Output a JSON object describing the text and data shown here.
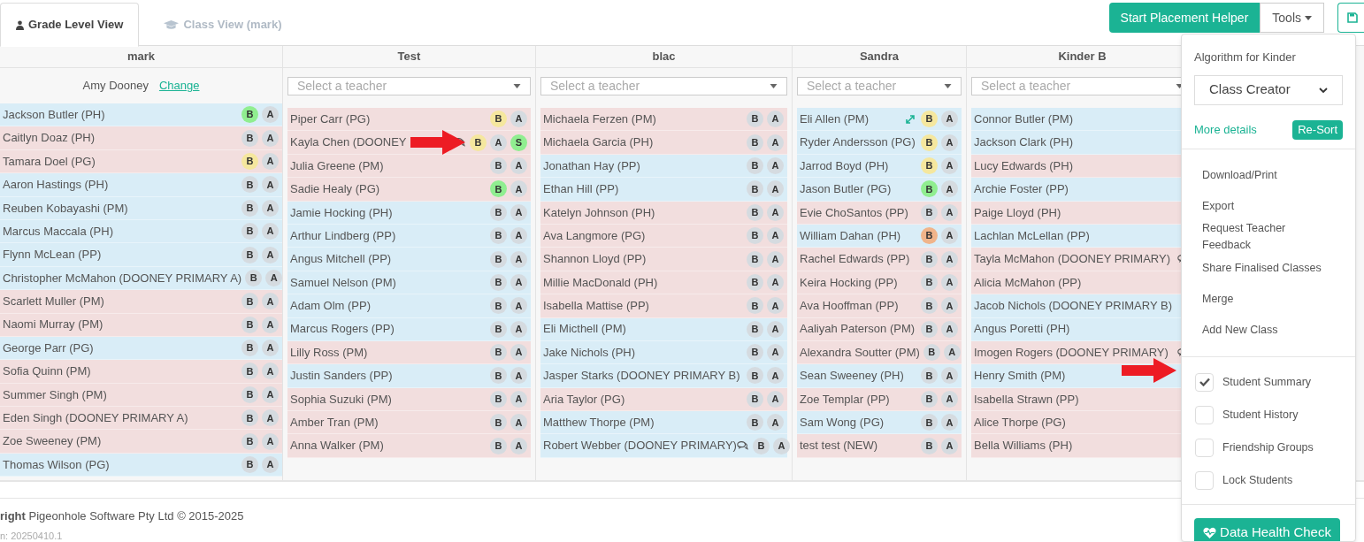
{
  "tabs": [
    {
      "label": "Grade Level View",
      "selected": true
    },
    {
      "label": "Class View (mark)",
      "selected": false
    }
  ],
  "toolbar": {
    "primary_button": "Start Placement Helper",
    "tools_button": "Tools"
  },
  "classes": [
    {
      "name": "mark",
      "teacher": {
        "name": "Amy Dooney",
        "action": "Change"
      },
      "students": [
        {
          "name": "Jackson Butler (PH)",
          "color": "#d9edf7",
          "badges": [
            {
              "letter": "B",
              "color": "#90ee90"
            },
            {
              "letter": "A",
              "color": "#d5dbe0"
            }
          ]
        },
        {
          "name": "Caitlyn Doaz (PH)",
          "color": "#f2dede",
          "badges": [
            {
              "letter": "B",
              "color": "#d5dbe0"
            },
            {
              "letter": "A",
              "color": "#d5dbe0"
            }
          ]
        },
        {
          "name": "Tamara Doel (PG)",
          "color": "#f2dede",
          "badges": [
            {
              "letter": "B",
              "color": "#f5e79e"
            },
            {
              "letter": "A",
              "color": "#d5dbe0"
            }
          ]
        },
        {
          "name": "Aaron Hastings (PH)",
          "color": "#d9edf7",
          "badges": [
            {
              "letter": "B",
              "color": "#d5dbe0"
            },
            {
              "letter": "A",
              "color": "#d5dbe0"
            }
          ]
        },
        {
          "name": "Reuben Kobayashi (PM)",
          "color": "#d9edf7",
          "badges": [
            {
              "letter": "B",
              "color": "#d5dbe0"
            },
            {
              "letter": "A",
              "color": "#d5dbe0"
            }
          ]
        },
        {
          "name": "Marcus Maccala (PH)",
          "color": "#d9edf7",
          "badges": [
            {
              "letter": "B",
              "color": "#d5dbe0"
            },
            {
              "letter": "A",
              "color": "#d5dbe0"
            }
          ]
        },
        {
          "name": "Flynn McLean (PP)",
          "color": "#d9edf7",
          "badges": [
            {
              "letter": "B",
              "color": "#d5dbe0"
            },
            {
              "letter": "A",
              "color": "#d5dbe0"
            }
          ]
        },
        {
          "name": "Christopher McMahon (DOONEY PRIMARY A)",
          "color": "#d9edf7",
          "badges": [
            {
              "letter": "B",
              "color": "#d5dbe0"
            },
            {
              "letter": "A",
              "color": "#d5dbe0"
            }
          ]
        },
        {
          "name": "Scarlett Muller (PM)",
          "color": "#f2dede",
          "badges": [
            {
              "letter": "B",
              "color": "#d5dbe0"
            },
            {
              "letter": "A",
              "color": "#d5dbe0"
            }
          ]
        },
        {
          "name": "Naomi Murray (PM)",
          "color": "#f2dede",
          "badges": [
            {
              "letter": "B",
              "color": "#d5dbe0"
            },
            {
              "letter": "A",
              "color": "#d5dbe0"
            }
          ]
        },
        {
          "name": "George Parr (PG)",
          "color": "#d9edf7",
          "badges": [
            {
              "letter": "B",
              "color": "#d5dbe0"
            },
            {
              "letter": "A",
              "color": "#d5dbe0"
            }
          ]
        },
        {
          "name": "Sofia Quinn (PM)",
          "color": "#f2dede",
          "badges": [
            {
              "letter": "B",
              "color": "#d5dbe0"
            },
            {
              "letter": "A",
              "color": "#d5dbe0"
            }
          ]
        },
        {
          "name": "Summer Singh (PM)",
          "color": "#f2dede",
          "badges": [
            {
              "letter": "B",
              "color": "#d5dbe0"
            },
            {
              "letter": "A",
              "color": "#d5dbe0"
            }
          ]
        },
        {
          "name": "Eden Singh (DOONEY PRIMARY A)",
          "color": "#f2dede",
          "badges": [
            {
              "letter": "B",
              "color": "#d5dbe0"
            },
            {
              "letter": "A",
              "color": "#d5dbe0"
            }
          ]
        },
        {
          "name": "Zoe Sweeney (PM)",
          "color": "#f2dede",
          "badges": [
            {
              "letter": "B",
              "color": "#d5dbe0"
            },
            {
              "letter": "A",
              "color": "#d5dbe0"
            }
          ]
        },
        {
          "name": "Thomas Wilson (PG)",
          "color": "#d9edf7",
          "badges": [
            {
              "letter": "B",
              "color": "#d5dbe0"
            },
            {
              "letter": "A",
              "color": "#d5dbe0"
            }
          ]
        }
      ]
    },
    {
      "name": "Test",
      "teacher": {
        "placeholder": "Select a teacher"
      },
      "students": [
        {
          "name": "Piper Carr (PG)",
          "color": "#f2dede",
          "badges": [
            {
              "letter": "B",
              "color": "#f5e79e"
            },
            {
              "letter": "A",
              "color": "#d5dbe0"
            }
          ]
        },
        {
          "name": "Kayla Chen (DOONEY",
          "color": "#f2dede",
          "comment": true,
          "badges": [
            {
              "letter": "B",
              "color": "#f5e79e"
            },
            {
              "letter": "A",
              "color": "#d5dbe0"
            },
            {
              "letter": "S",
              "color": "#90ee90"
            }
          ]
        },
        {
          "name": "Julia Greene (PM)",
          "color": "#f2dede",
          "badges": [
            {
              "letter": "B",
              "color": "#d5dbe0"
            },
            {
              "letter": "A",
              "color": "#d5dbe0"
            }
          ]
        },
        {
          "name": "Sadie Healy (PG)",
          "color": "#f2dede",
          "badges": [
            {
              "letter": "B",
              "color": "#90ee90"
            },
            {
              "letter": "A",
              "color": "#d5dbe0"
            }
          ]
        },
        {
          "name": "Jamie Hocking (PH)",
          "color": "#d9edf7",
          "badges": [
            {
              "letter": "B",
              "color": "#d5dbe0"
            },
            {
              "letter": "A",
              "color": "#d5dbe0"
            }
          ]
        },
        {
          "name": "Arthur Lindberg (PP)",
          "color": "#d9edf7",
          "badges": [
            {
              "letter": "B",
              "color": "#d5dbe0"
            },
            {
              "letter": "A",
              "color": "#d5dbe0"
            }
          ]
        },
        {
          "name": "Angus Mitchell (PP)",
          "color": "#d9edf7",
          "badges": [
            {
              "letter": "B",
              "color": "#d5dbe0"
            },
            {
              "letter": "A",
              "color": "#d5dbe0"
            }
          ]
        },
        {
          "name": "Samuel Nelson (PM)",
          "color": "#d9edf7",
          "badges": [
            {
              "letter": "B",
              "color": "#d5dbe0"
            },
            {
              "letter": "A",
              "color": "#d5dbe0"
            }
          ]
        },
        {
          "name": "Adam Olm (PP)",
          "color": "#d9edf7",
          "badges": [
            {
              "letter": "B",
              "color": "#d5dbe0"
            },
            {
              "letter": "A",
              "color": "#d5dbe0"
            }
          ]
        },
        {
          "name": "Marcus Rogers (PP)",
          "color": "#d9edf7",
          "badges": [
            {
              "letter": "B",
              "color": "#d5dbe0"
            },
            {
              "letter": "A",
              "color": "#d5dbe0"
            }
          ]
        },
        {
          "name": "Lilly Ross (PM)",
          "color": "#f2dede",
          "badges": [
            {
              "letter": "B",
              "color": "#d5dbe0"
            },
            {
              "letter": "A",
              "color": "#d5dbe0"
            }
          ]
        },
        {
          "name": "Justin Sanders (PP)",
          "color": "#d9edf7",
          "badges": [
            {
              "letter": "B",
              "color": "#d5dbe0"
            },
            {
              "letter": "A",
              "color": "#d5dbe0"
            }
          ]
        },
        {
          "name": "Sophia Suzuki (PM)",
          "color": "#f2dede",
          "badges": [
            {
              "letter": "B",
              "color": "#d5dbe0"
            },
            {
              "letter": "A",
              "color": "#d5dbe0"
            }
          ]
        },
        {
          "name": "Amber Tran (PM)",
          "color": "#f2dede",
          "badges": [
            {
              "letter": "B",
              "color": "#d5dbe0"
            },
            {
              "letter": "A",
              "color": "#d5dbe0"
            }
          ]
        },
        {
          "name": "Anna Walker (PM)",
          "color": "#f2dede",
          "badges": [
            {
              "letter": "B",
              "color": "#d5dbe0"
            },
            {
              "letter": "A",
              "color": "#d5dbe0"
            }
          ]
        }
      ]
    },
    {
      "name": "blac",
      "teacher": {
        "placeholder": "Select a teacher"
      },
      "students": [
        {
          "name": "Michaela Ferzen (PM)",
          "color": "#f2dede",
          "badges": [
            {
              "letter": "B",
              "color": "#d5dbe0"
            },
            {
              "letter": "A",
              "color": "#d5dbe0"
            }
          ]
        },
        {
          "name": "Michaela Garcia (PH)",
          "color": "#f2dede",
          "badges": [
            {
              "letter": "B",
              "color": "#d5dbe0"
            },
            {
              "letter": "A",
              "color": "#d5dbe0"
            }
          ]
        },
        {
          "name": "Jonathan Hay (PP)",
          "color": "#d9edf7",
          "badges": [
            {
              "letter": "B",
              "color": "#d5dbe0"
            },
            {
              "letter": "A",
              "color": "#d5dbe0"
            }
          ]
        },
        {
          "name": "Ethan Hill (PP)",
          "color": "#d9edf7",
          "badges": [
            {
              "letter": "B",
              "color": "#d5dbe0"
            },
            {
              "letter": "A",
              "color": "#d5dbe0"
            }
          ]
        },
        {
          "name": "Katelyn Johnson (PH)",
          "color": "#f2dede",
          "badges": [
            {
              "letter": "B",
              "color": "#d5dbe0"
            },
            {
              "letter": "A",
              "color": "#d5dbe0"
            }
          ]
        },
        {
          "name": "Ava Langmore (PG)",
          "color": "#f2dede",
          "badges": [
            {
              "letter": "B",
              "color": "#d5dbe0"
            },
            {
              "letter": "A",
              "color": "#d5dbe0"
            }
          ]
        },
        {
          "name": "Shannon Lloyd (PP)",
          "color": "#f2dede",
          "badges": [
            {
              "letter": "B",
              "color": "#d5dbe0"
            },
            {
              "letter": "A",
              "color": "#d5dbe0"
            }
          ]
        },
        {
          "name": "Millie MacDonald (PH)",
          "color": "#f2dede",
          "badges": [
            {
              "letter": "B",
              "color": "#d5dbe0"
            },
            {
              "letter": "A",
              "color": "#d5dbe0"
            }
          ]
        },
        {
          "name": "Isabella Mattise (PP)",
          "color": "#f2dede",
          "badges": [
            {
              "letter": "B",
              "color": "#d5dbe0"
            },
            {
              "letter": "A",
              "color": "#d5dbe0"
            }
          ]
        },
        {
          "name": "Eli Micthell (PM)",
          "color": "#d9edf7",
          "badges": [
            {
              "letter": "B",
              "color": "#d5dbe0"
            },
            {
              "letter": "A",
              "color": "#d5dbe0"
            }
          ]
        },
        {
          "name": "Jake Nichols (PH)",
          "color": "#d9edf7",
          "badges": [
            {
              "letter": "B",
              "color": "#d5dbe0"
            },
            {
              "letter": "A",
              "color": "#d5dbe0"
            }
          ]
        },
        {
          "name": "Jasper Starks (DOONEY PRIMARY B)",
          "color": "#d9edf7",
          "badges": [
            {
              "letter": "B",
              "color": "#d5dbe0"
            },
            {
              "letter": "A",
              "color": "#d5dbe0"
            }
          ]
        },
        {
          "name": "Aria Taylor (PG)",
          "color": "#f2dede",
          "badges": [
            {
              "letter": "B",
              "color": "#d5dbe0"
            },
            {
              "letter": "A",
              "color": "#d5dbe0"
            }
          ]
        },
        {
          "name": "Matthew Thorpe (PM)",
          "color": "#d9edf7",
          "badges": [
            {
              "letter": "B",
              "color": "#d5dbe0"
            },
            {
              "letter": "A",
              "color": "#d5dbe0"
            }
          ]
        },
        {
          "name": "Robert Webber (DOONEY PRIMARY)",
          "color": "#d9edf7",
          "comment": true,
          "badges": [
            {
              "letter": "B",
              "color": "#d5dbe0"
            },
            {
              "letter": "A",
              "color": "#d5dbe0"
            }
          ]
        }
      ]
    },
    {
      "name": "Sandra",
      "teacher": {
        "placeholder": "Select a teacher"
      },
      "students": [
        {
          "name": "Eli Allen (PM)",
          "color": "#d9edf7",
          "expand": true,
          "badges": [
            {
              "letter": "B",
              "color": "#f5e79e"
            },
            {
              "letter": "A",
              "color": "#d5dbe0"
            }
          ]
        },
        {
          "name": "Ryder Andersson (PG)",
          "color": "#d9edf7",
          "badges": [
            {
              "letter": "B",
              "color": "#f5e79e"
            },
            {
              "letter": "A",
              "color": "#d5dbe0"
            }
          ]
        },
        {
          "name": "Jarrod Boyd (PH)",
          "color": "#d9edf7",
          "badges": [
            {
              "letter": "B",
              "color": "#f5e79e"
            },
            {
              "letter": "A",
              "color": "#d5dbe0"
            }
          ]
        },
        {
          "name": "Jason Butler (PG)",
          "color": "#d9edf7",
          "badges": [
            {
              "letter": "B",
              "color": "#90ee90"
            },
            {
              "letter": "A",
              "color": "#d5dbe0"
            }
          ]
        },
        {
          "name": "Evie ChoSantos (PP)",
          "color": "#f2dede",
          "badges": [
            {
              "letter": "B",
              "color": "#d5dbe0"
            },
            {
              "letter": "A",
              "color": "#d5dbe0"
            }
          ]
        },
        {
          "name": "William Dahan (PH)",
          "color": "#d9edf7",
          "badges": [
            {
              "letter": "B",
              "color": "#f0b48a"
            },
            {
              "letter": "A",
              "color": "#d5dbe0"
            }
          ]
        },
        {
          "name": "Rachel Edwards (PP)",
          "color": "#f2dede",
          "badges": [
            {
              "letter": "B",
              "color": "#d5dbe0"
            },
            {
              "letter": "A",
              "color": "#d5dbe0"
            }
          ]
        },
        {
          "name": "Keira Hocking (PP)",
          "color": "#f2dede",
          "badges": [
            {
              "letter": "B",
              "color": "#d5dbe0"
            },
            {
              "letter": "A",
              "color": "#d5dbe0"
            }
          ]
        },
        {
          "name": "Ava Hooffman (PP)",
          "color": "#f2dede",
          "badges": [
            {
              "letter": "B",
              "color": "#d5dbe0"
            },
            {
              "letter": "A",
              "color": "#d5dbe0"
            }
          ]
        },
        {
          "name": "Aaliyah Paterson (PM)",
          "color": "#f2dede",
          "badges": [
            {
              "letter": "B",
              "color": "#d5dbe0"
            },
            {
              "letter": "A",
              "color": "#d5dbe0"
            }
          ]
        },
        {
          "name": "Alexandra Soutter (PM)",
          "color": "#f2dede",
          "badges": [
            {
              "letter": "B",
              "color": "#d5dbe0"
            },
            {
              "letter": "A",
              "color": "#d5dbe0"
            }
          ]
        },
        {
          "name": "Sean Sweeney (PH)",
          "color": "#d9edf7",
          "badges": [
            {
              "letter": "B",
              "color": "#d5dbe0"
            },
            {
              "letter": "A",
              "color": "#d5dbe0"
            }
          ]
        },
        {
          "name": "Zoe Templar (PP)",
          "color": "#f2dede",
          "badges": [
            {
              "letter": "B",
              "color": "#d5dbe0"
            },
            {
              "letter": "A",
              "color": "#d5dbe0"
            }
          ]
        },
        {
          "name": "Sam Wong (PG)",
          "color": "#d9edf7",
          "badges": [
            {
              "letter": "B",
              "color": "#d5dbe0"
            },
            {
              "letter": "A",
              "color": "#d5dbe0"
            }
          ]
        },
        {
          "name": "test test (NEW)",
          "color": "#f2dede",
          "badges": [
            {
              "letter": "B",
              "color": "#d5dbe0"
            },
            {
              "letter": "A",
              "color": "#d5dbe0"
            }
          ]
        }
      ]
    },
    {
      "name": "Kinder B",
      "teacher": {
        "placeholder": "Select a teacher"
      },
      "students": [
        {
          "name": "Connor Butler (PM)",
          "color": "#d9edf7"
        },
        {
          "name": "Jackson Clark (PH)",
          "color": "#d9edf7"
        },
        {
          "name": "Lucy Edwards (PH)",
          "color": "#f2dede"
        },
        {
          "name": "Archie Foster (PP)",
          "color": "#d9edf7"
        },
        {
          "name": "Paige Lloyd (PH)",
          "color": "#f2dede"
        },
        {
          "name": "Lachlan McLellan (PP)",
          "color": "#d9edf7"
        },
        {
          "name": "Tayla McMahon (DOONEY PRIMARY)",
          "color": "#f2dede",
          "comment": true
        },
        {
          "name": "Alicia McMahon (PP)",
          "color": "#f2dede"
        },
        {
          "name": "Jacob Nichols (DOONEY PRIMARY B)",
          "color": "#d9edf7"
        },
        {
          "name": "Angus Poretti (PH)",
          "color": "#d9edf7"
        },
        {
          "name": "Imogen Rogers (DOONEY PRIMARY)",
          "color": "#f2dede",
          "comment": true
        },
        {
          "name": "Henry Smith (PM)",
          "color": "#d9edf7"
        },
        {
          "name": "Isabella Strawn (PP)",
          "color": "#f2dede"
        },
        {
          "name": "Alice Thorpe (PG)",
          "color": "#f2dede"
        },
        {
          "name": "Bella Williams (PH)",
          "color": "#f2dede"
        }
      ]
    }
  ],
  "tools_menu": {
    "algorithm_label": "Algorithm for Kinder",
    "algorithm_value": "Class Creator",
    "details_link": "More details",
    "resort_button": "Re-Sort",
    "items": [
      "Download/Print",
      "Export",
      "Request Teacher Feedback",
      "Share Finalised Classes",
      "Merge",
      "Add New Class"
    ],
    "toggles": [
      {
        "label": "Student Summary",
        "checked": true
      },
      {
        "label": "Student History",
        "checked": false
      },
      {
        "label": "Friendship Groups",
        "checked": false
      },
      {
        "label": "Lock Students",
        "checked": false
      }
    ],
    "health_button": "Data Health Check"
  },
  "footer": {
    "copyright": "**right** Pigeonhole Software Pty Ltd © 2015-2025",
    "version": "n: 20250410.1"
  },
  "annotations": [
    {
      "kind": "arrow"
    },
    {
      "kind": "arrow"
    }
  ]
}
